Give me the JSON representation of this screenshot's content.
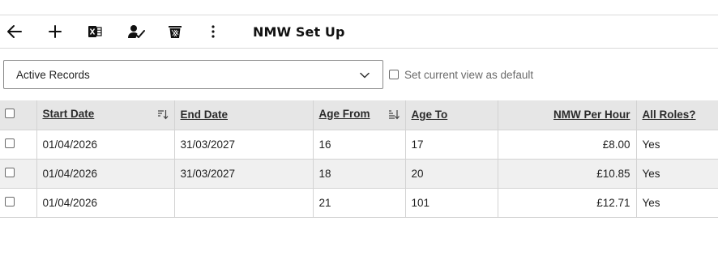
{
  "toolbar": {
    "icons": [
      "back-arrow-icon",
      "plus-icon",
      "excel-icon",
      "user-check-icon",
      "delete-icon",
      "more-vertical-icon"
    ],
    "title": "NMW Set Up"
  },
  "view": {
    "selected": "Active Records",
    "default_label": "Set current view as default"
  },
  "grid": {
    "columns": [
      {
        "label": "Start Date",
        "sort": "sort-icon"
      },
      {
        "label": "End Date"
      },
      {
        "label": "Age From",
        "sort": "sort-desc-icon"
      },
      {
        "label": "Age To"
      },
      {
        "label": "NMW Per Hour",
        "align": "right"
      },
      {
        "label": "All Roles?"
      }
    ],
    "rows": [
      {
        "start_date": "01/04/2026",
        "end_date": "31/03/2027",
        "age_from": "16",
        "age_to": "17",
        "nmw": "£8.00",
        "all_roles": "Yes"
      },
      {
        "start_date": "01/04/2026",
        "end_date": "31/03/2027",
        "age_from": "18",
        "age_to": "20",
        "nmw": "£10.85",
        "all_roles": "Yes"
      },
      {
        "start_date": "01/04/2026",
        "end_date": "",
        "age_from": "21",
        "age_to": "101",
        "nmw": "£12.71",
        "all_roles": "Yes"
      }
    ]
  }
}
